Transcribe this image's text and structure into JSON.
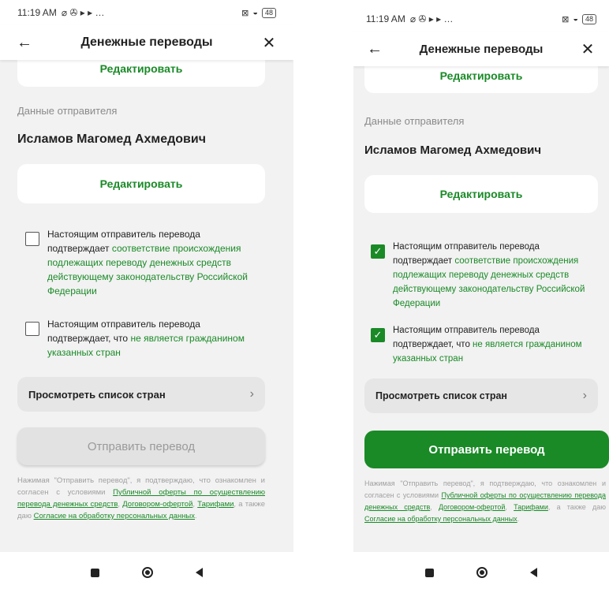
{
  "status": {
    "time": "11:19 AM",
    "left_icons": "⌀ ✇ ▸ ▸ …",
    "sim": "⊠",
    "wifi": "◒",
    "battery": "48"
  },
  "header": {
    "title": "Денежные переводы",
    "back_icon": "←",
    "close_icon": "✕"
  },
  "edit_label": "Редактировать",
  "sender": {
    "section_label": "Данные отправителя",
    "name": "Исламов Магомед Ахмедович"
  },
  "checks": [
    {
      "prefix": "Настоящим отправитель перевода подтверждает ",
      "link": "соответствие происхождения подлежащих переводу денежных средств действующему законодательству Российской Федерации",
      "suffix": ""
    },
    {
      "prefix": "Настоящим отправитель перевода подтверждает, что ",
      "link": "не является гражданином указанных стран",
      "suffix": ""
    }
  ],
  "checked_mark": "✓",
  "countries_label": "Просмотреть список стран",
  "chevron": "›",
  "send_label": "Отправить перевод",
  "legal": {
    "p1": "Нажимая \"Отправить перевод\", я подтверждаю, что ознакомлен и согласен с условиями ",
    "l1": "Публичной оферты по осуществлению перевода денежных средств",
    "p2": ", ",
    "l2": "Договором-офертой",
    "p3": ", ",
    "l3": "Тарифами",
    "p4": ", а также даю ",
    "l4": "Согласие на обработку персональных данных",
    "p5": "."
  },
  "screens": [
    {
      "state": "unchecked",
      "send_enabled": false
    },
    {
      "state": "checked",
      "send_enabled": true
    }
  ],
  "colors": {
    "accent": "#1a8a27",
    "disabled_button": "#e2e2e2",
    "background": "#f2f2f2"
  }
}
